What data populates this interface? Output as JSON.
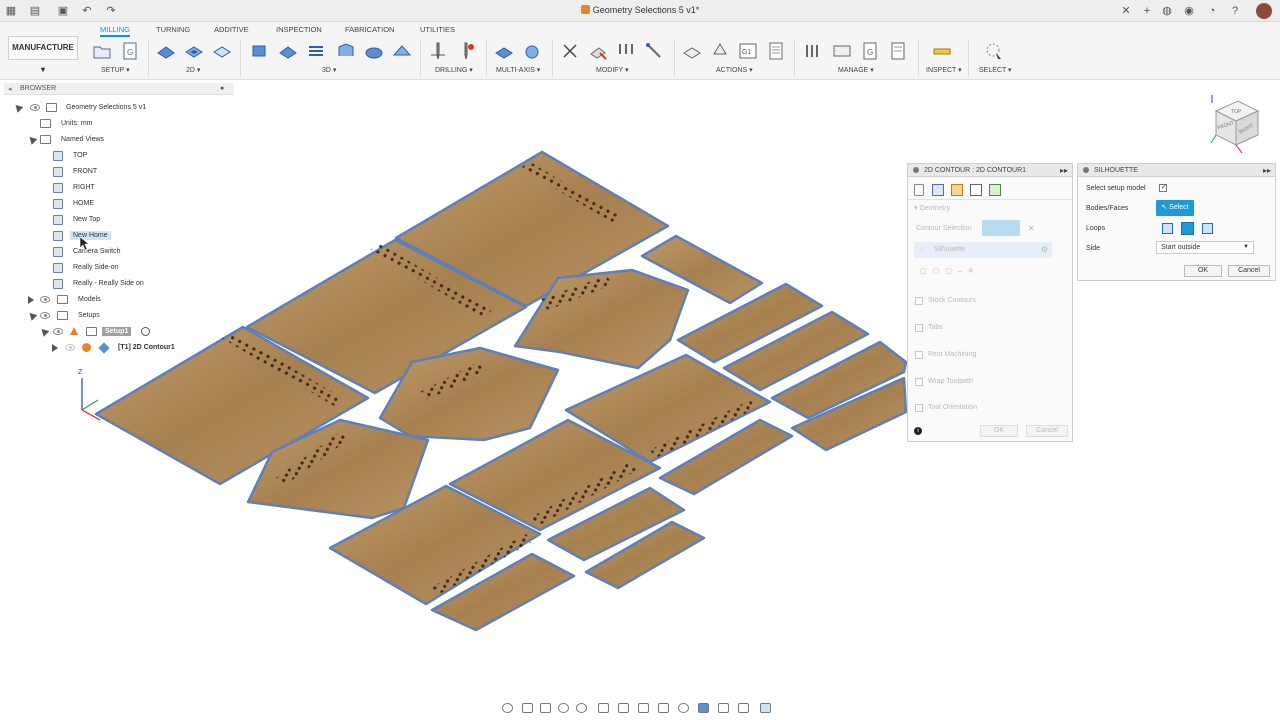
{
  "document": {
    "title": "Geometry Selections 5 v1*"
  },
  "workspace": {
    "label": "MANUFACTURE"
  },
  "tabs": [
    "MILLING",
    "TURNING",
    "ADDITIVE",
    "INSPECTION",
    "FABRICATION",
    "UTILITIES"
  ],
  "active_tab": "MILLING",
  "groups": {
    "setup": "SETUP",
    "g2d": "2D",
    "g3d": "3D",
    "drilling": "DRILLING",
    "multiaxis": "MULTI-AXIS",
    "modify": "MODIFY",
    "actions": "ACTIONS",
    "manage": "MANAGE",
    "inspect": "INSPECT",
    "select": "SELECT"
  },
  "browser": {
    "title": "BROWSER",
    "root": "Geometry Selections 5 v1",
    "units": "Units: mm",
    "named_views_label": "Named Views",
    "named_views": [
      "TOP",
      "FRONT",
      "RIGHT",
      "HOME",
      "New Top",
      "New Home",
      "Camera Switch",
      "Really Side-on",
      "Really - Really Side on"
    ],
    "models": "Models",
    "setups": "Setups",
    "setup1": "Setup1",
    "operation": "[T1] 2D Contour1"
  },
  "contour_panel": {
    "title": "2D CONTOUR : 2D CONTOUR1",
    "section": "Geometry",
    "contour_selection_label": "Contour Selection",
    "silhouette_item": "Silhouette",
    "options": [
      "Stock Contours",
      "Tabs",
      "Rest Machining",
      "Wrap Toolpath",
      "Tool Orientation"
    ],
    "ok": "OK",
    "cancel": "Cancel"
  },
  "silhouette_panel": {
    "title": "SILHOUETTE",
    "select_setup_model": "Select setup model",
    "bodies_faces": "Bodies/Faces",
    "select_btn": "Select",
    "loops": "Loops",
    "side": "Side",
    "side_value": "Start outside",
    "ok": "OK",
    "cancel": "Cancel"
  },
  "viewcube": {
    "top": "TOP",
    "front": "FRONT",
    "right": "RIGHT"
  },
  "axis": {
    "z": "Z"
  },
  "colors": {
    "accent": "#0696d7",
    "wood": "#b08a5c",
    "edge": "#5e7fb8"
  }
}
